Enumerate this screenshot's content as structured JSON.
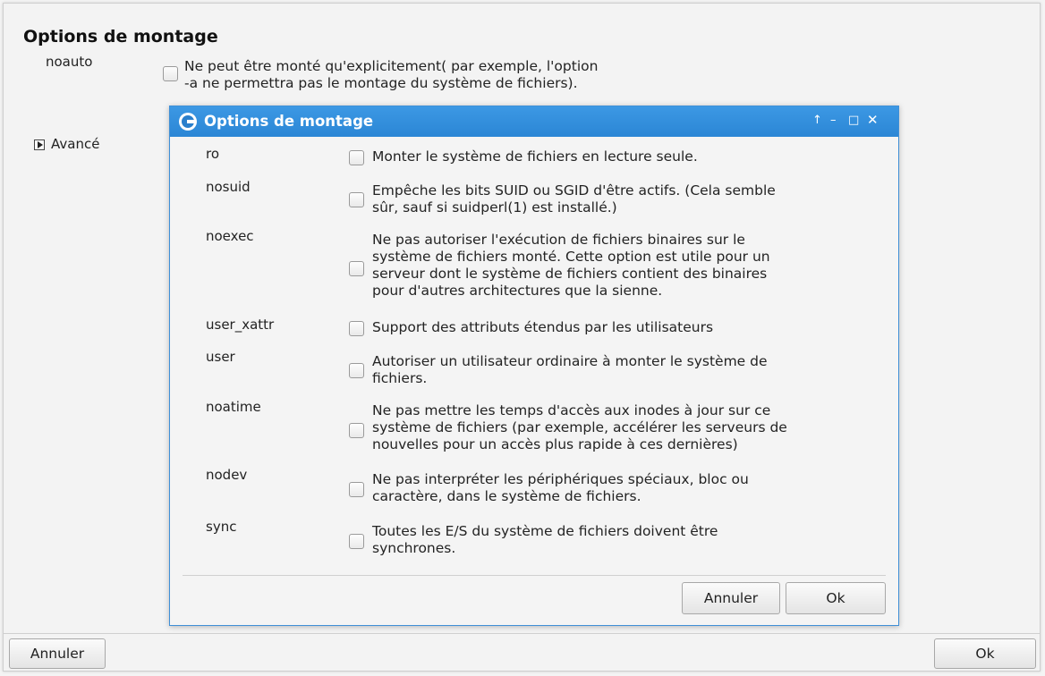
{
  "outer": {
    "title": "Options de montage",
    "noauto": {
      "name": "noauto",
      "desc1": "Ne peut être monté qu'explicitement( par exemple, l'option",
      "desc2": "-a ne permettra pas le montage du système de fichiers)."
    },
    "advanced_label": "Avancé",
    "cancel_label": "Annuler",
    "ok_label": "Ok"
  },
  "dialog": {
    "title": "Options de montage",
    "options": [
      {
        "name": "ro",
        "lines": [
          "Monter le système de fichiers en lecture seule."
        ]
      },
      {
        "name": "nosuid",
        "lines": [
          "Empêche les bits SUID ou SGID d'être actifs. (Cela semble",
          "sûr, sauf si suidperl(1) est installé.)"
        ]
      },
      {
        "name": "noexec",
        "lines": [
          "Ne pas autoriser l'exécution de fichiers binaires sur le",
          "système de fichiers monté. Cette option est utile pour un",
          "serveur dont le système de fichiers contient des binaires",
          "pour d'autres architectures que la sienne."
        ]
      },
      {
        "name": "user_xattr",
        "lines": [
          "Support des attributs étendus par les utilisateurs"
        ]
      },
      {
        "name": "user",
        "lines": [
          "Autoriser un utilisateur ordinaire à monter le système de",
          "fichiers."
        ]
      },
      {
        "name": "noatime",
        "lines": [
          "Ne pas mettre les temps d'accès aux inodes à jour sur ce",
          "système de fichiers (par exemple, accélérer les serveurs de",
          "nouvelles pour un accès plus rapide à ces dernières)"
        ]
      },
      {
        "name": "nodev",
        "lines": [
          "Ne pas interpréter les périphériques spéciaux, bloc ou",
          "caractère, dans le système de fichiers."
        ]
      },
      {
        "name": "sync",
        "lines": [
          "Toutes les E/S du système de fichiers doivent être",
          "synchrones."
        ]
      }
    ],
    "cancel_label": "Annuler",
    "ok_label": "Ok"
  }
}
